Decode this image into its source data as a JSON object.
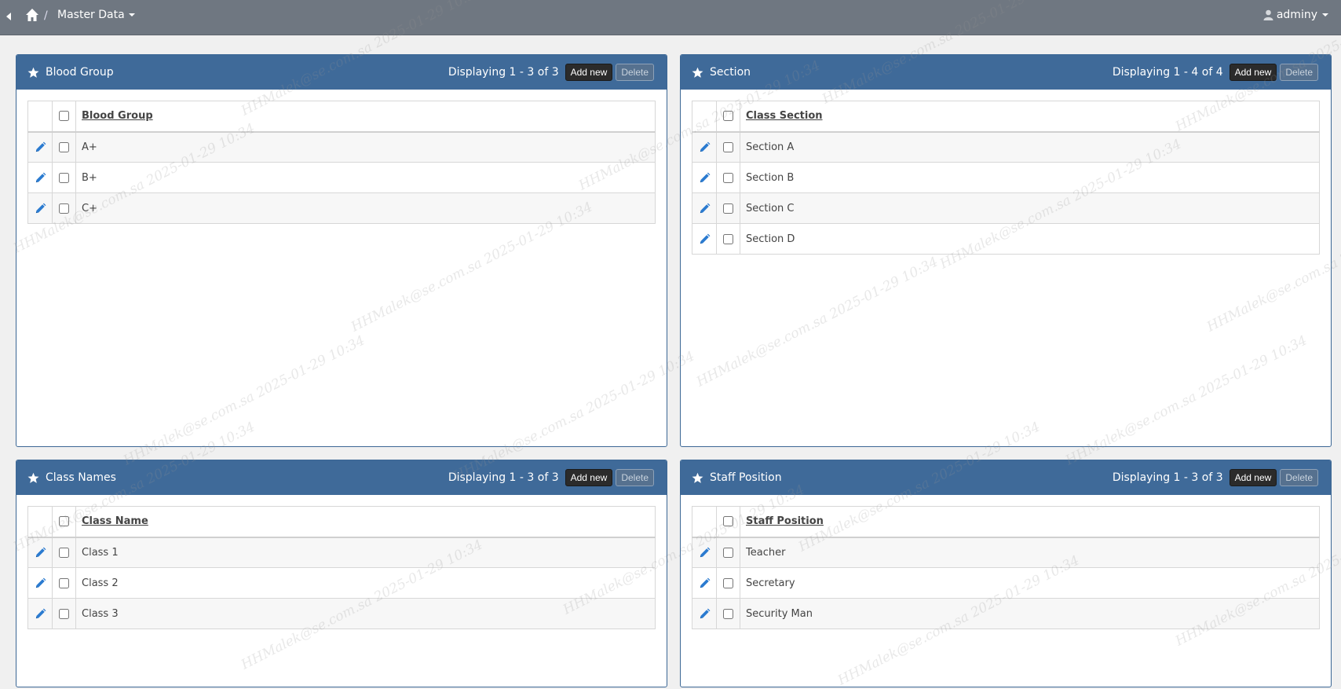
{
  "topbar": {
    "breadcrumb_separator": "/",
    "breadcrumb_label": "Master Data",
    "user_name": "adminy"
  },
  "watermark": "HHMalek@se.com.sa 2025-01-29 10:34",
  "panels": [
    {
      "title": "Blood Group",
      "count_text": "Displaying 1 - 3 of 3",
      "add_label": "Add new",
      "delete_label": "Delete",
      "column": "Blood Group",
      "rows": [
        "A+",
        "B+",
        "C+"
      ]
    },
    {
      "title": "Section",
      "count_text": "Displaying 1 - 4 of 4",
      "add_label": "Add new",
      "delete_label": "Delete",
      "column": "Class Section",
      "rows": [
        "Section A",
        "Section B",
        "Section C",
        "Section D"
      ]
    },
    {
      "title": "Class Names",
      "count_text": "Displaying 1 - 3 of 3",
      "add_label": "Add new",
      "delete_label": "Delete",
      "column": "Class Name",
      "rows": [
        "Class 1",
        "Class 2",
        "Class 3"
      ]
    },
    {
      "title": "Staff Position",
      "count_text": "Displaying 1 - 3 of 3",
      "add_label": "Add new",
      "delete_label": "Delete",
      "column": "Staff Position",
      "rows": [
        "Teacher",
        "Secretary",
        "Security Man"
      ]
    }
  ],
  "colors": {
    "topbar": "#6f7781",
    "panel_header": "#3f6a99",
    "edit_icon": "#2b7bd0"
  }
}
